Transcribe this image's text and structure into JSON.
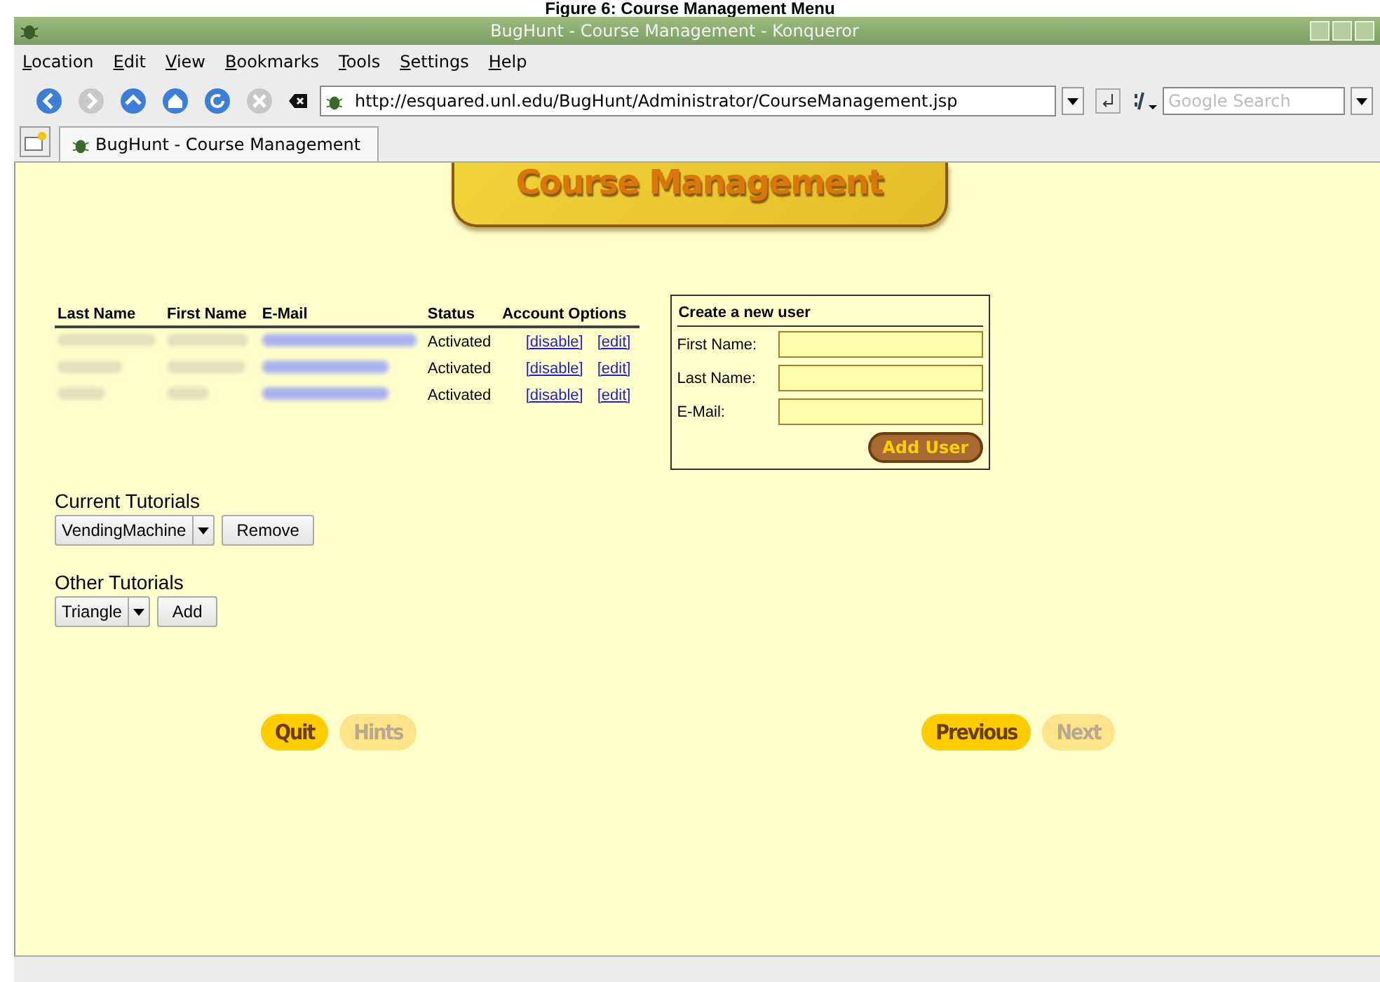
{
  "caption": "Figure 6: Course Management Menu",
  "window": {
    "title": "BugHunt - Course Management - Konqueror"
  },
  "menu": [
    {
      "label": "Location"
    },
    {
      "label": "Edit"
    },
    {
      "label": "View"
    },
    {
      "label": "Bookmarks"
    },
    {
      "label": "Tools"
    },
    {
      "label": "Settings"
    },
    {
      "label": "Help"
    }
  ],
  "toolbar": {
    "buttons": [
      {
        "kind": "back",
        "disabled": false
      },
      {
        "kind": "forward",
        "disabled": true
      },
      {
        "kind": "up",
        "disabled": false
      },
      {
        "kind": "home",
        "disabled": false
      },
      {
        "kind": "reload",
        "disabled": false
      },
      {
        "kind": "stop",
        "disabled": true
      }
    ],
    "url": "http://esquared.unl.edu/BugHunt/Administrator/CourseManagement.jsp",
    "search": {
      "placeholder": "Google Search"
    }
  },
  "tabs": [
    {
      "label": "BugHunt - Course Management",
      "selected": true
    }
  ],
  "page": {
    "banner": "Course Management",
    "users_table": {
      "columns": [
        "Last Name",
        "First Name",
        "E-Mail",
        "Status",
        "Account Options"
      ],
      "rows": [
        {
          "status": "Activated",
          "actions": [
            "[disable]",
            "[edit]"
          ]
        },
        {
          "status": "Activated",
          "actions": [
            "[disable]",
            "[edit]"
          ]
        },
        {
          "status": "Activated",
          "actions": [
            "[disable]",
            "[edit]"
          ]
        }
      ]
    },
    "new_user_form": {
      "title": "Create a new user",
      "fields": [
        {
          "label": "First Name:"
        },
        {
          "label": "Last Name:"
        },
        {
          "label": "E-Mail:"
        }
      ],
      "submit": "Add User"
    },
    "tutorial_groups": [
      {
        "heading": "Current Tutorials",
        "selected": "VendingMachine",
        "button": "Remove"
      },
      {
        "heading": "Other Tutorials",
        "selected": "Triangle",
        "button": "Add"
      }
    ],
    "nav": [
      [
        {
          "label": "Quit",
          "disabled": false
        },
        {
          "label": "Hints",
          "disabled": true
        }
      ],
      [
        {
          "label": "Previous",
          "disabled": false
        },
        {
          "label": "Next",
          "disabled": true
        }
      ]
    ]
  }
}
